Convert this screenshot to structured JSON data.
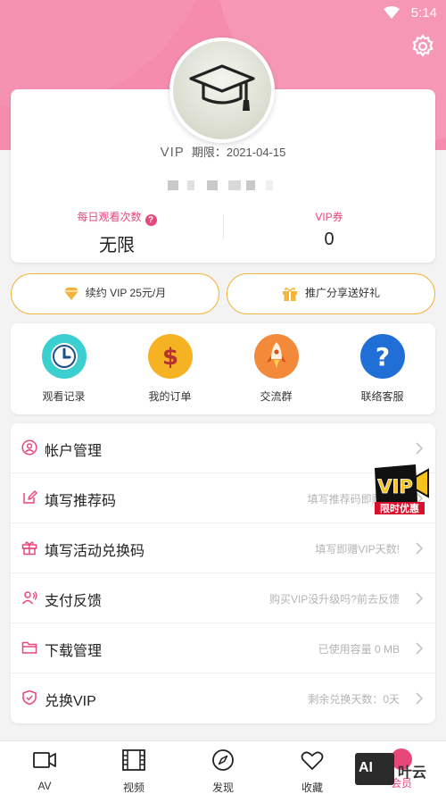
{
  "status_bar": {
    "time": "5:14"
  },
  "profile": {
    "vip_label": "VIP",
    "expiry_prefix": "期限：",
    "expiry_date": "2021-04-15",
    "stats": [
      {
        "label": "每日观看次数",
        "value": "无限"
      },
      {
        "label": "VIP券",
        "value": "0"
      }
    ]
  },
  "promos": [
    {
      "label": "续约 VIP 25元/月",
      "icon": "diamond-icon"
    },
    {
      "label": "推广分享送好礼",
      "icon": "gift-icon"
    }
  ],
  "quick_actions": [
    {
      "label": "观看记录",
      "icon": "clock-icon",
      "color": "#3ccfcf"
    },
    {
      "label": "我的订单",
      "icon": "dollar-icon",
      "color": "#f5b323"
    },
    {
      "label": "交流群",
      "icon": "rocket-icon",
      "color": "#f28a3a"
    },
    {
      "label": "联络客服",
      "icon": "question-icon",
      "color": "#1f6fd6"
    }
  ],
  "menu": [
    {
      "label": "帐户管理",
      "hint": "",
      "icon": "user-icon"
    },
    {
      "label": "填写推荐码",
      "hint": "填写推荐码即赠VIP",
      "icon": "edit-icon"
    },
    {
      "label": "填写活动兑换码",
      "hint": "填写即赠VIP天数!",
      "icon": "gift-icon"
    },
    {
      "label": "支付反馈",
      "hint": "购买VIP没升级吗?前去反馈",
      "icon": "feedback-icon"
    },
    {
      "label": "下载管理",
      "hint": "已使用容量 0 MB",
      "icon": "folder-icon"
    },
    {
      "label": "兑换VIP",
      "hint": "剩余兑换天数：0天",
      "icon": "shield-icon"
    }
  ],
  "vip_badge": {
    "top": "VIP",
    "bottom": "限时优惠"
  },
  "tabs": [
    {
      "label": "AV",
      "icon": "camera-icon"
    },
    {
      "label": "视频",
      "icon": "film-icon"
    },
    {
      "label": "发现",
      "icon": "compass-icon"
    },
    {
      "label": "收藏",
      "icon": "heart-icon"
    },
    {
      "label": "会员",
      "icon": "member-icon"
    }
  ],
  "watermark": {
    "box_text": "AI",
    "text": "叶云"
  },
  "colors": {
    "header": "#f58cad",
    "accent": "#e8477a",
    "promo_border": "#f2b43c"
  }
}
